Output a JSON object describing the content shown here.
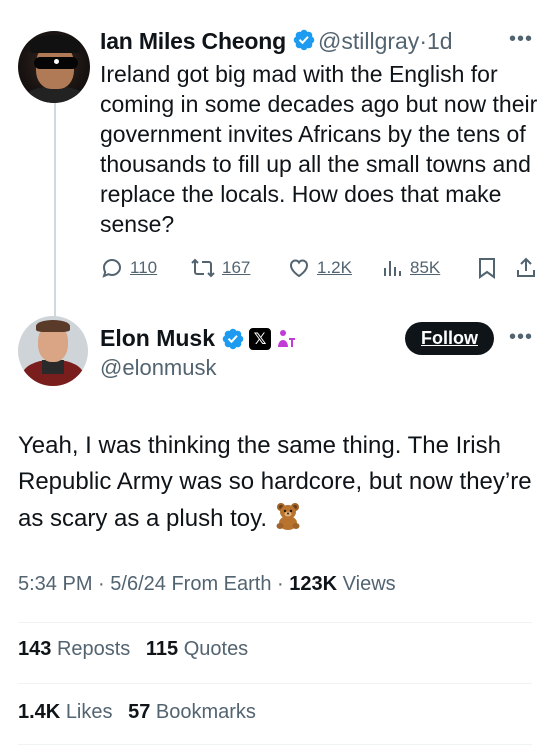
{
  "parent_tweet": {
    "author_name": "Ian Miles Cheong",
    "handle": "@stillgray",
    "separator": "·",
    "time_ago": "1d",
    "text": "Ireland got big mad with the English for coming in some decades ago but now their government invites Africans by the tens of thousands to fill up all the small towns and replace the locals. How does that make sense?",
    "replies": "110",
    "reposts": "167",
    "likes": "1.2K",
    "views": "85K",
    "more_icon": "more-horizontal-icon"
  },
  "main_tweet": {
    "author_name": "Elon Musk",
    "handle": "@elonmusk",
    "follow_label": "Follow",
    "text": "Yeah, I was thinking the same thing. The Irish Republic Army was so hardcore, but now they’re as scary as a plush toy.",
    "emoji": "🧸",
    "time": "5:34 PM",
    "date": "5/6/24",
    "source": "From Earth",
    "dot": "·",
    "views_count": "123K",
    "views_label": "Views",
    "reposts_count": "143",
    "reposts_label": "Reposts",
    "quotes_count": "115",
    "quotes_label": "Quotes",
    "likes_count": "1.4K",
    "likes_label": "Likes",
    "bookmarks_count": "57",
    "bookmarks_label": "Bookmarks",
    "badge_x": "𝕏"
  },
  "colors": {
    "verified_blue": "#1d9bf0",
    "text_primary": "#0f1419",
    "text_secondary": "#536471",
    "accessibility_badge": "#c13bd6"
  }
}
